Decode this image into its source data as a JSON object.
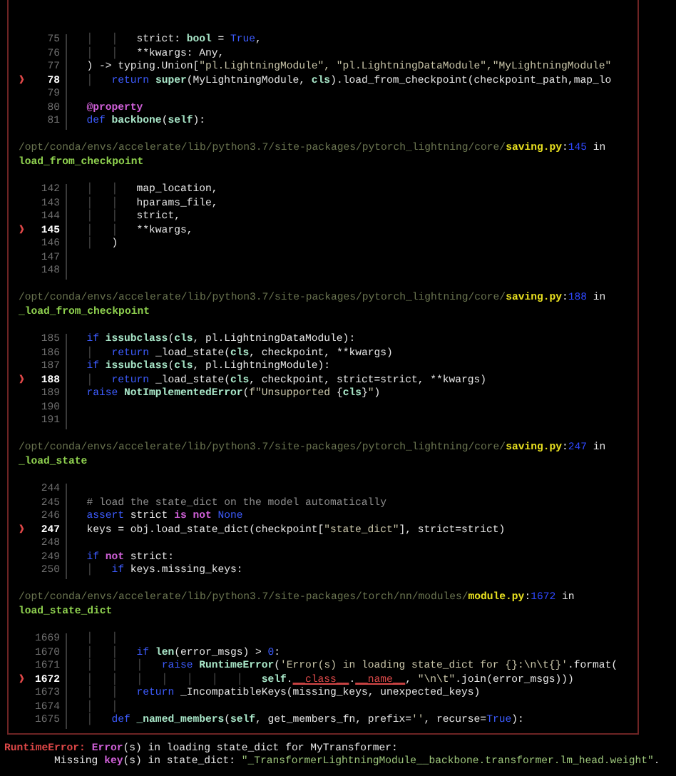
{
  "frames": [
    {
      "lines": [
        {
          "num": "75",
          "current": false,
          "tokens": [
            {
              "text": "  │   │   ",
              "kind": "guide"
            },
            {
              "text": "strict: ",
              "kind": "plain"
            },
            {
              "text": "bool",
              "kind": "name"
            },
            {
              "text": " = ",
              "kind": "plain"
            },
            {
              "text": "True",
              "kind": "keyword"
            },
            {
              "text": ",",
              "kind": "plain"
            }
          ]
        },
        {
          "num": "76",
          "current": false,
          "tokens": [
            {
              "text": "  │   │   ",
              "kind": "guide"
            },
            {
              "text": "**kwargs: Any,",
              "kind": "plain"
            }
          ]
        },
        {
          "num": "77",
          "current": false,
          "tokens": [
            {
              "text": "  ) -> typing.Union[",
              "kind": "plain"
            },
            {
              "text": "\"pl.LightningModule\", \"pl.LightningDataModule\",\"MyLightningModule\"",
              "kind": "string"
            }
          ]
        },
        {
          "num": "78",
          "current": true,
          "marker": "❱",
          "tokens": [
            {
              "text": "  │   ",
              "kind": "guide"
            },
            {
              "text": "return",
              "kind": "keyword"
            },
            {
              "text": " super",
              "kind": "name"
            },
            {
              "text": "(MyLightningModule, ",
              "kind": "plain"
            },
            {
              "text": "cls",
              "kind": "name"
            },
            {
              "text": ").load_from_checkpoint(checkpoint_path,map_lo",
              "kind": "plain"
            }
          ]
        },
        {
          "num": "79",
          "current": false
        },
        {
          "num": "80",
          "current": false,
          "tokens": [
            {
              "text": "  @property",
              "kind": "magenta"
            }
          ]
        },
        {
          "num": "81",
          "current": false,
          "tokens": [
            {
              "text": "  def",
              "kind": "keyword"
            },
            {
              "text": " backbone",
              "kind": "name"
            },
            {
              "text": "(",
              "kind": "plain"
            },
            {
              "text": "self",
              "kind": "name"
            },
            {
              "text": "):",
              "kind": "plain"
            }
          ]
        }
      ]
    },
    {
      "header": {
        "dir": "/opt/conda/envs/accelerate/lib/python3.7/site-packages/pytorch_lightning/core/",
        "file": "saving.py",
        "colon": ":",
        "line": "145",
        "in_word": "in",
        "func": "load_from_checkpoint"
      },
      "lines": [
        {
          "num": "142",
          "current": false,
          "tokens": [
            {
              "text": "  │   │   ",
              "kind": "guide"
            },
            {
              "text": "map_location,",
              "kind": "plain"
            }
          ]
        },
        {
          "num": "143",
          "current": false,
          "tokens": [
            {
              "text": "  │   │   ",
              "kind": "guide"
            },
            {
              "text": "hparams_file,",
              "kind": "plain"
            }
          ]
        },
        {
          "num": "144",
          "current": false,
          "tokens": [
            {
              "text": "  │   │   ",
              "kind": "guide"
            },
            {
              "text": "strict,",
              "kind": "plain"
            }
          ]
        },
        {
          "num": "145",
          "current": true,
          "marker": "❱",
          "tokens": [
            {
              "text": "  │   │   ",
              "kind": "guide"
            },
            {
              "text": "**kwargs,",
              "kind": "plain"
            }
          ]
        },
        {
          "num": "146",
          "current": false,
          "tokens": [
            {
              "text": "  │   ",
              "kind": "guide"
            },
            {
              "text": ")",
              "kind": "plain"
            }
          ]
        },
        {
          "num": "147",
          "current": false
        },
        {
          "num": "148",
          "current": false
        }
      ]
    },
    {
      "header": {
        "dir": "/opt/conda/envs/accelerate/lib/python3.7/site-packages/pytorch_lightning/core/",
        "file": "saving.py",
        "colon": ":",
        "line": "188",
        "in_word": "in",
        "func": "_load_from_checkpoint"
      },
      "lines": [
        {
          "num": "185",
          "current": false,
          "tokens": [
            {
              "text": "  if",
              "kind": "keyword"
            },
            {
              "text": " issubclass",
              "kind": "name"
            },
            {
              "text": "(",
              "kind": "plain"
            },
            {
              "text": "cls",
              "kind": "name"
            },
            {
              "text": ", pl.LightningDataModule):",
              "kind": "plain"
            }
          ]
        },
        {
          "num": "186",
          "current": false,
          "tokens": [
            {
              "text": "  │   ",
              "kind": "guide"
            },
            {
              "text": "return",
              "kind": "keyword"
            },
            {
              "text": " _load_state(",
              "kind": "plain"
            },
            {
              "text": "cls",
              "kind": "name"
            },
            {
              "text": ", checkpoint, **kwargs)",
              "kind": "plain"
            }
          ]
        },
        {
          "num": "187",
          "current": false,
          "tokens": [
            {
              "text": "  if",
              "kind": "keyword"
            },
            {
              "text": " issubclass",
              "kind": "name"
            },
            {
              "text": "(",
              "kind": "plain"
            },
            {
              "text": "cls",
              "kind": "name"
            },
            {
              "text": ", pl.LightningModule):",
              "kind": "plain"
            }
          ]
        },
        {
          "num": "188",
          "current": true,
          "marker": "❱",
          "tokens": [
            {
              "text": "  │   ",
              "kind": "guide"
            },
            {
              "text": "return",
              "kind": "keyword"
            },
            {
              "text": " _load_state(",
              "kind": "plain"
            },
            {
              "text": "cls",
              "kind": "name"
            },
            {
              "text": ", checkpoint, strict=strict, **kwargs)",
              "kind": "plain"
            }
          ]
        },
        {
          "num": "189",
          "current": false,
          "tokens": [
            {
              "text": "  raise",
              "kind": "keyword"
            },
            {
              "text": " NotImplementedError",
              "kind": "name"
            },
            {
              "text": "(",
              "kind": "plain"
            },
            {
              "text": "f\"Unsupported ",
              "kind": "string"
            },
            {
              "text": "{",
              "kind": "plain"
            },
            {
              "text": "cls",
              "kind": "name"
            },
            {
              "text": "}",
              "kind": "plain"
            },
            {
              "text": "\"",
              "kind": "string"
            },
            {
              "text": ")",
              "kind": "plain"
            }
          ]
        },
        {
          "num": "190",
          "current": false
        },
        {
          "num": "191",
          "current": false
        }
      ]
    },
    {
      "header": {
        "dir": "/opt/conda/envs/accelerate/lib/python3.7/site-packages/pytorch_lightning/core/",
        "file": "saving.py",
        "colon": ":",
        "line": "247",
        "in_word": "in",
        "func": "_load_state"
      },
      "lines": [
        {
          "num": "244",
          "current": false
        },
        {
          "num": "245",
          "current": false,
          "tokens": [
            {
              "text": "  # load the state_dict on the model automatically",
              "kind": "comment"
            }
          ]
        },
        {
          "num": "246",
          "current": false,
          "tokens": [
            {
              "text": "  assert",
              "kind": "keyword"
            },
            {
              "text": " strict ",
              "kind": "plain"
            },
            {
              "text": "is not",
              "kind": "magenta"
            },
            {
              "text": " None",
              "kind": "keyword"
            }
          ]
        },
        {
          "num": "247",
          "current": true,
          "marker": "❱",
          "tokens": [
            {
              "text": "  keys = obj.load_state_dict(checkpoint[",
              "kind": "plain"
            },
            {
              "text": "\"state_dict\"",
              "kind": "string"
            },
            {
              "text": "], strict=strict)",
              "kind": "plain"
            }
          ]
        },
        {
          "num": "248",
          "current": false
        },
        {
          "num": "249",
          "current": false,
          "tokens": [
            {
              "text": "  if",
              "kind": "keyword"
            },
            {
              "text": " not",
              "kind": "magenta"
            },
            {
              "text": " strict:",
              "kind": "plain"
            }
          ]
        },
        {
          "num": "250",
          "current": false,
          "tokens": [
            {
              "text": "  │   ",
              "kind": "guide"
            },
            {
              "text": "if",
              "kind": "keyword"
            },
            {
              "text": " keys.missing_keys:",
              "kind": "plain"
            }
          ]
        }
      ]
    },
    {
      "header": {
        "dir": "/opt/conda/envs/accelerate/lib/python3.7/site-packages/torch/nn/modules/",
        "file": "module.py",
        "colon": ":",
        "line": "1672",
        "in_word": "in",
        "func": "load_state_dict"
      },
      "lines": [
        {
          "num": "1669",
          "current": false,
          "tokens": [
            {
              "text": "  │   │",
              "kind": "guide"
            }
          ]
        },
        {
          "num": "1670",
          "current": false,
          "tokens": [
            {
              "text": "  │   │   ",
              "kind": "guide"
            },
            {
              "text": "if",
              "kind": "keyword"
            },
            {
              "text": " len",
              "kind": "name"
            },
            {
              "text": "(error_msgs) > ",
              "kind": "plain"
            },
            {
              "text": "0",
              "kind": "keyword"
            },
            {
              "text": ":",
              "kind": "plain"
            }
          ]
        },
        {
          "num": "1671",
          "current": false,
          "tokens": [
            {
              "text": "  │   │   │   ",
              "kind": "guide"
            },
            {
              "text": "raise",
              "kind": "keyword"
            },
            {
              "text": " RuntimeError",
              "kind": "name"
            },
            {
              "text": "(",
              "kind": "plain"
            },
            {
              "text": "'Error(s) in loading state_dict for {}:\\n\\t{}'",
              "kind": "string"
            },
            {
              "text": ".format(",
              "kind": "plain"
            }
          ]
        },
        {
          "num": "1672",
          "current": true,
          "marker": "❱",
          "tokens": [
            {
              "text": "  │   │   │   │   │   │   │   ",
              "kind": "guide"
            },
            {
              "text": "self",
              "kind": "name"
            },
            {
              "text": ".",
              "kind": "plain"
            },
            {
              "text": "__class__",
              "kind": "dunder"
            },
            {
              "text": ".",
              "kind": "plain"
            },
            {
              "text": "__name__",
              "kind": "dunder"
            },
            {
              "text": ", ",
              "kind": "plain"
            },
            {
              "text": "\"\\n\\t\"",
              "kind": "string"
            },
            {
              "text": ".join(error_msgs)))",
              "kind": "plain"
            }
          ]
        },
        {
          "num": "1673",
          "current": false,
          "tokens": [
            {
              "text": "  │   │   ",
              "kind": "guide"
            },
            {
              "text": "return",
              "kind": "keyword"
            },
            {
              "text": " _IncompatibleKeys(missing_keys, unexpected_keys)",
              "kind": "plain"
            }
          ]
        },
        {
          "num": "1674",
          "current": false,
          "tokens": [
            {
              "text": "  │   │",
              "kind": "guide"
            }
          ]
        },
        {
          "num": "1675",
          "current": false,
          "tokens": [
            {
              "text": "  │   ",
              "kind": "guide"
            },
            {
              "text": "def",
              "kind": "keyword"
            },
            {
              "text": " _named_members",
              "kind": "name"
            },
            {
              "text": "(",
              "kind": "plain"
            },
            {
              "text": "self",
              "kind": "name"
            },
            {
              "text": ", get_members_fn, prefix=",
              "kind": "plain"
            },
            {
              "text": "''",
              "kind": "string"
            },
            {
              "text": ", recurse=",
              "kind": "plain"
            },
            {
              "text": "True",
              "kind": "keyword"
            },
            {
              "text": "):",
              "kind": "plain"
            }
          ]
        }
      ]
    }
  ],
  "error_lines": [
    {
      "tokens": [
        {
          "text": "RuntimeError: ",
          "kind": "error"
        },
        {
          "text": "Error",
          "kind": "magenta"
        },
        {
          "text": "(s) in loading state_dict for MyTransformer:",
          "kind": "plain"
        }
      ]
    },
    {
      "tokens": [
        {
          "text": "        Missing ",
          "kind": "plain"
        },
        {
          "text": "key",
          "kind": "magenta"
        },
        {
          "text": "(s) in state_dict: ",
          "kind": "plain"
        },
        {
          "text": "\"_TransformerLightningModule__backbone.transformer.lm_head.weight\"",
          "kind": "green"
        },
        {
          "text": ".",
          "kind": "plain"
        }
      ]
    }
  ]
}
